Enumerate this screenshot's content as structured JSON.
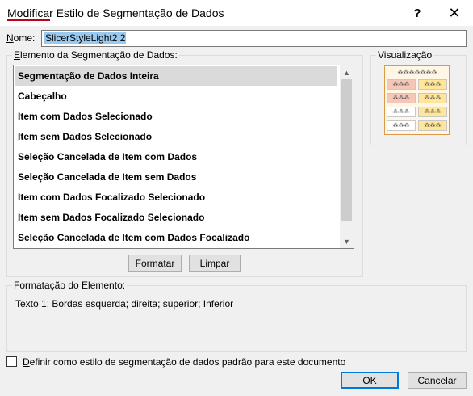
{
  "window": {
    "title_underlined": "Modificar",
    "title_rest": " Estilo de Segmentação de Dados",
    "help_glyph": "?",
    "close_glyph": "✕"
  },
  "name_field": {
    "label_key": "N",
    "label_rest": "ome:",
    "value": "SlicerStyleLight2 2"
  },
  "element_group": {
    "title_key": "E",
    "title_rest": "lemento da Segmentação de Dados:",
    "items": [
      "Segmentação de Dados Inteira",
      "Cabeçalho",
      "Item com Dados Selecionado",
      "Item sem Dados Selecionado",
      "Seleção Cancelada de Item com Dados",
      "Seleção Cancelada de Item sem Dados",
      "Item com Dados Focalizado Selecionado",
      "Item sem Dados Focalizado Selecionado",
      "Seleção Cancelada de Item com Dados Focalizado"
    ],
    "selected_index": 0
  },
  "buttons": {
    "format_key": "F",
    "format_rest": "ormatar",
    "clear_key": "L",
    "clear_rest": "impar",
    "ok": "OK",
    "cancel": "Cancelar"
  },
  "preview": {
    "title": "Visualização",
    "header_text": "⁂⁂⁂⁂⁂⁂⁂",
    "cell_text": "⁂⁂⁂",
    "colors": {
      "selected_left": "#f4c7b8",
      "selected_right": "#ffe699",
      "unselected": "#ffffff",
      "border": "#d99a4a"
    }
  },
  "format_group": {
    "title": "Formatação do Elemento:",
    "text": "Texto 1; Bordas esquerda; direita; superior; Inferior"
  },
  "default_checkbox": {
    "label_key": "D",
    "label_rest": "efinir como estilo de segmentação de dados padrão para este documento",
    "checked": false
  }
}
